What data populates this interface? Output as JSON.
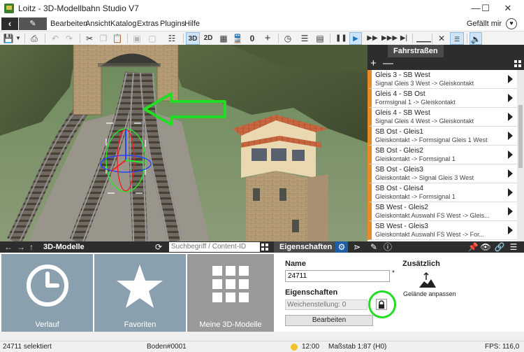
{
  "window": {
    "title": "Loitz - 3D-Modellbahn Studio V7",
    "minimize": "—",
    "maximize": "☐",
    "close": "✕"
  },
  "menu": {
    "items": [
      "Bearbeiten",
      "Ansicht",
      "Katalog",
      "Extras",
      "Plugins",
      "Hilfe"
    ],
    "like_label": "Gefällt mir",
    "heart": "♥"
  },
  "toolbar": {
    "btn_3d": "3D",
    "btn_2d": "2D",
    "counter": "0",
    "plus": "+"
  },
  "routes_panel": {
    "title": "Fahrstraßen",
    "add": "+",
    "remove": "—",
    "items": [
      {
        "name": "Gleis 3 - SB West",
        "detail": "Signal Gleis 3 West -> Gleiskontakt"
      },
      {
        "name": "Gleis 4 - SB Ost",
        "detail": "Formsignal 1 -> Gleiskontakt"
      },
      {
        "name": "Gleis 4 - SB West",
        "detail": "Signal Gleis 4 West -> Gleiskontakt"
      },
      {
        "name": "SB Ost - Gleis1",
        "detail": "Gleiskontakt -> Formsignal Gleis 1 West"
      },
      {
        "name": "SB Ost - Gleis2",
        "detail": "Gleiskontakt -> Formsignal 1"
      },
      {
        "name": "SB Ost - Gleis3",
        "detail": "Gleiskontakt -> Signal Gleis 3 West"
      },
      {
        "name": "SB Ost - Gleis4",
        "detail": "Gleiskontakt -> Formsignal 1"
      },
      {
        "name": "SB West - Gleis2",
        "detail": "Gleiskontakt Auswahl FS West -> Gleis..."
      },
      {
        "name": "SB West - Gleis3",
        "detail": "Gleiskontakt Auswahl FS West -> For..."
      }
    ]
  },
  "models_panel": {
    "title": "3D-Modelle",
    "search_placeholder": "Suchbegriff / Content-ID",
    "tiles": [
      "Verlauf",
      "Favoriten",
      "Meine 3D-Modelle"
    ]
  },
  "properties_panel": {
    "title": "Eigenschaften",
    "name_label": "Name",
    "name_value": "24711",
    "required_mark": "*",
    "props_label": "Eigenschaften",
    "switch_placeholder": "Weichenstellung: 0",
    "edit_button": "Bearbeiten",
    "extra_label": "Zusätzlich",
    "terrain_label": "Gelände anpassen"
  },
  "status": {
    "selection": "24711 selektiert",
    "floor": "Boden#0001",
    "time": "12:00",
    "scale": "Maßstab 1:87 (H0)",
    "fps": "FPS: 116,0"
  },
  "colors": {
    "accent": "#1e78c8",
    "route_marker": "#e8892a",
    "highlight": "#22dd22",
    "dark_bar": "#2d2d2d"
  }
}
